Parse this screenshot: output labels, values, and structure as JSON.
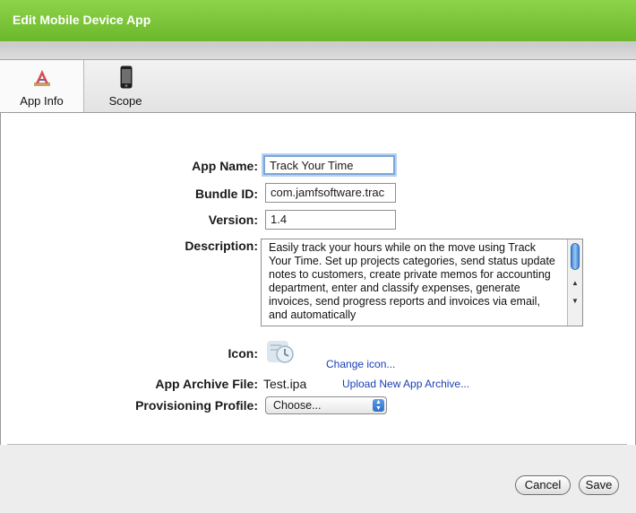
{
  "window": {
    "title": "Edit Mobile Device App"
  },
  "tabs": [
    {
      "label": "App Info",
      "icon": "app-info-icon",
      "active": true
    },
    {
      "label": "Scope",
      "icon": "iphone-icon",
      "active": false
    }
  ],
  "form": {
    "app_name": {
      "label": "App Name:",
      "value": "Track Your Time"
    },
    "bundle_id": {
      "label": "Bundle ID:",
      "value": "com.jamfsoftware.trac"
    },
    "version": {
      "label": "Version:",
      "value": "1.4"
    },
    "description": {
      "label": "Description:",
      "value": "Easily track your hours while on the move using Track Your Time. Set up projects categories, send status update notes to customers, create private memos for accounting department, enter and classify expenses, generate invoices, send progress reports and invoices via email, and automatically"
    },
    "icon": {
      "label": "Icon:",
      "change_link": "Change icon..."
    },
    "archive": {
      "label": "App Archive File:",
      "value": "Test.ipa",
      "upload_link": "Upload New App Archive..."
    },
    "profile": {
      "label": "Provisioning Profile:",
      "selected": "Choose..."
    }
  },
  "buttons": {
    "cancel": "Cancel",
    "save": "Save"
  },
  "colors": {
    "titlebar": "#7cc43b",
    "link": "#1b3fb5",
    "focus": "#7aa6d8"
  }
}
